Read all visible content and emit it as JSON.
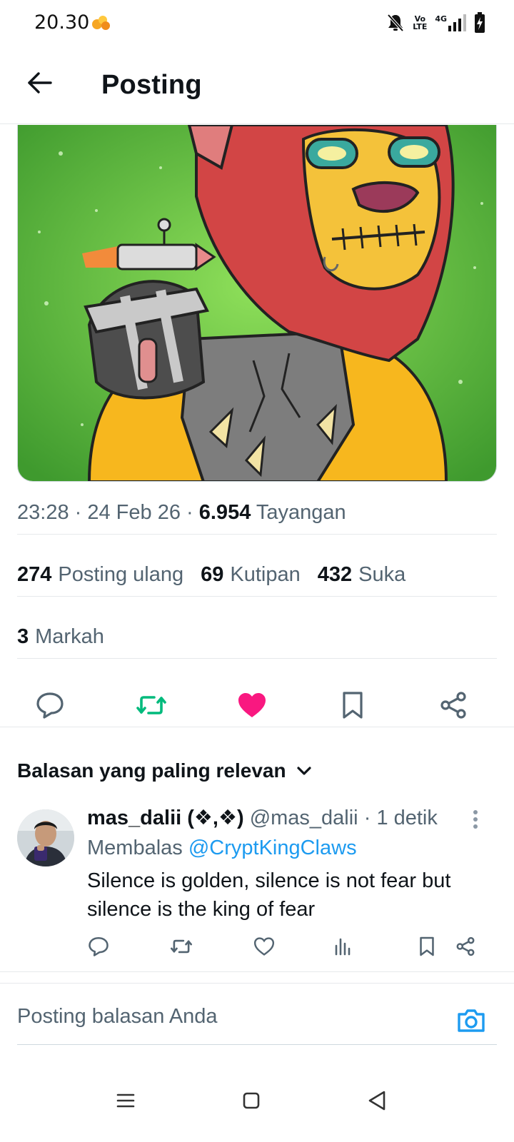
{
  "status_bar": {
    "time": "20.30",
    "volte_label": "Vo LTE",
    "network_label": "4G"
  },
  "header": {
    "title": "Posting"
  },
  "post": {
    "time": "23:28",
    "date": "24 Feb 26",
    "views_count": "6.954",
    "views_label": "Tayangan",
    "reposts_count": "274",
    "reposts_label": "Posting ulang",
    "quotes_count": "69",
    "quotes_label": "Kutipan",
    "likes_count": "432",
    "likes_label": "Suka",
    "bookmarks_count": "3",
    "bookmarks_label": "Markah",
    "liked": true,
    "like_color": "#f91880",
    "repost_color": "#00ba7c"
  },
  "replies": {
    "sort_label": "Balasan yang paling relevan",
    "items": [
      {
        "name": "mas_dalii (❖,❖)",
        "handle": "@mas_dalii",
        "time": "1 detik",
        "replying_label": "Membalas",
        "replying_to": "@CryptKingClaws",
        "text": "Silence is golden, silence is not fear but silence is the king of fear"
      }
    ]
  },
  "composer": {
    "placeholder": "Posting balasan Anda",
    "accent": "#1d9bf0"
  },
  "icons": {
    "back": "arrow-left-icon",
    "reply": "speech-bubble-icon",
    "repost": "repost-arrows-icon",
    "like": "heart-icon",
    "bookmark": "bookmark-icon",
    "share": "share-icon",
    "views": "bar-chart-icon",
    "camera": "camera-icon"
  }
}
